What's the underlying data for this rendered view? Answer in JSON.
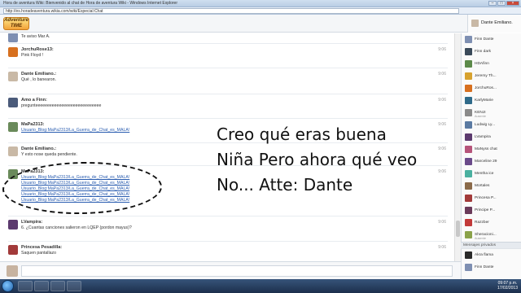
{
  "window": {
    "title": "Hora de aventura Wiki: Bienvenido al chat de Hora de aventura Wiki - Windows Internet Explorer",
    "url": "http://es.horadeaventura.wikia.com/wiki/Especial:Chat"
  },
  "header": {
    "logo_text": "Adventure TIME",
    "current_user": "Dante Emiliano."
  },
  "messages": [
    {
      "id": "m0",
      "user": "",
      "time": "",
      "lines": [
        {
          "text": "Te aviso Mar A.",
          "link": false
        }
      ],
      "color": "#7e8fb2"
    },
    {
      "id": "m1",
      "user": "JorchuRose13:",
      "time": "9:06",
      "lines": [
        {
          "text": "Pink Floyd !",
          "link": false
        }
      ],
      "color": "#d7701f"
    },
    {
      "id": "m2",
      "user": "Dante Emiliano.:",
      "time": "9:06",
      "lines": [
        {
          "text": "Qué , lo banearon.",
          "link": false
        }
      ],
      "color": "#c9b9a6"
    },
    {
      "id": "m3",
      "user": "Amo a Finn:",
      "time": "9:06",
      "lines": [
        {
          "text": "pregunteeeeeeeeeeeeeeeeeeeeeeeeeeee",
          "link": false
        }
      ],
      "color": "#4b5b7a"
    },
    {
      "id": "m4",
      "user": "MaPa2313:",
      "time": "9:06",
      "lines": [
        {
          "text": "Usuario_Blog:MaPa2313/La_Guerra_de_Chat_es_MALA!",
          "link": true
        }
      ],
      "color": "#6a8a5a"
    },
    {
      "id": "m5",
      "user": "Dante Emiliano.:",
      "time": "9:06",
      "lines": [
        {
          "text": "Y esto nose queda pendiente.",
          "link": false
        }
      ],
      "color": "#c9b9a6"
    },
    {
      "id": "m6",
      "user": "MaPa2313:",
      "time": "9:06",
      "lines": [
        {
          "text": "Usuario_Blog:MaPa2313/La_Guerra_de_Chat_es_MALA!",
          "link": true
        },
        {
          "text": "Usuario_Blog:MaPa2313/La_Guerra_de_Chat_es_MALA!",
          "link": true
        },
        {
          "text": "Usuario_Blog:MaPa2313/La_Guerra_de_Chat_es_MALA!",
          "link": true
        },
        {
          "text": "Usuario_Blog:MaPa2313/La_Guerra_de_Chat_es_MALA!",
          "link": true
        },
        {
          "text": "Usuario_Blog:MaPa2313/La_Guerra_de_Chat_es_MALA!",
          "link": true
        }
      ],
      "color": "#6a8a5a"
    },
    {
      "id": "m7",
      "user": "LVampira:",
      "time": "9:06",
      "lines": [
        {
          "text": "6. ¿Cuantas canciones salieron en LQEP (pordon mayus)?",
          "link": false
        }
      ],
      "color": "#5c3a6e"
    },
    {
      "id": "m8",
      "user": "Princesa Pesadilla:",
      "time": "9:06",
      "lines": [
        {
          "text": "Saquen pantallazo",
          "link": false
        }
      ],
      "color": "#a23a3a"
    }
  ],
  "users": [
    {
      "name": "Finn Dante",
      "status": "",
      "color": "#7e8fb2"
    },
    {
      "name": "Finn dark",
      "status": "",
      "color": "#3a4a5a"
    },
    {
      "name": "HDAfinn",
      "status": "",
      "color": "#5c8a4a"
    },
    {
      "name": "Jeremy Th...",
      "status": "",
      "color": "#d7a22f"
    },
    {
      "name": "JorchuRos...",
      "status": "",
      "color": "#d7701f"
    },
    {
      "name": "KarlyMarie",
      "status": "",
      "color": "#2f6a8a"
    },
    {
      "name": "KENJI",
      "status": "Ausente",
      "color": "#8a8a8a"
    },
    {
      "name": "Ludwig Ly...",
      "status": "",
      "color": "#5a7aa2"
    },
    {
      "name": "LVampira",
      "status": "",
      "color": "#5c3a6e"
    },
    {
      "name": "MaNyss chat",
      "status": "",
      "color": "#b6547a"
    },
    {
      "name": "Marceline 29",
      "status": "",
      "color": "#6a4a8a"
    },
    {
      "name": "Mentha ice",
      "status": "",
      "color": "#4ab0a0"
    },
    {
      "name": "Mortales",
      "status": "",
      "color": "#8a6a4a"
    },
    {
      "name": "Princesa P...",
      "status": "",
      "color": "#a23a3a"
    },
    {
      "name": "Principe P...",
      "status": "",
      "color": "#6a3a5a"
    },
    {
      "name": "Razzber",
      "status": "",
      "color": "#c23a3a"
    },
    {
      "name": "Sheracioni...",
      "status": "Ausente",
      "color": "#8aa24a"
    }
  ],
  "private_header": "Mensajes privados",
  "private_users": [
    {
      "name": "Akra flama",
      "color": "#2a2a2a"
    },
    {
      "name": "Finn Dante",
      "color": "#7e8fb2"
    }
  ],
  "overlay": {
    "lines": [
      "Creo qué eras buena",
      "Niña Pero ahora qué veo",
      "No... Atte: Dante"
    ]
  },
  "clock": {
    "time": "09:07 p.m.",
    "date": "17/02/2013"
  }
}
